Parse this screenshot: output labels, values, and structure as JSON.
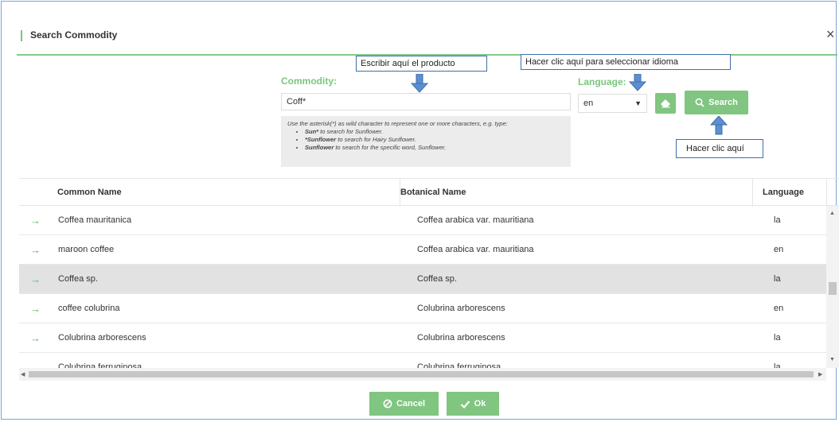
{
  "dialog": {
    "title": "Search Commodity",
    "close_label": "×"
  },
  "search": {
    "commodity_label": "Commodity:",
    "commodity_value": "Coff*",
    "language_label": "Language:",
    "language_value": "en",
    "hint_intro": "Use the asterisk(*) as wild character to represent one or more characters, e.g. type:",
    "hint_items": [
      {
        "bold": "Sun*",
        "text": " to search for Sunflower."
      },
      {
        "bold": "*Sunflower",
        "text": " to search for Hairy Sunflower."
      },
      {
        "bold": "Sunflower",
        "text": " to search for the specific word, Sunflower."
      }
    ],
    "search_label": "Search"
  },
  "callouts": {
    "product": "Escribir aquí el producto",
    "language": "Hacer clic aquí para seleccionar  idioma",
    "click": "Hacer clic aquí"
  },
  "table": {
    "headers": {
      "common": "Common Name",
      "botanical": "Botanical Name",
      "language": "Language"
    },
    "rows": [
      {
        "common": "Coffea mauritanica",
        "botanical": "Coffea arabica var. mauritiana",
        "language": "la"
      },
      {
        "common": "maroon coffee",
        "botanical": "Coffea arabica var. mauritiana",
        "language": "en"
      },
      {
        "common": "Coffea sp.",
        "botanical": "Coffea sp.",
        "language": "la"
      },
      {
        "common": "coffee colubrina",
        "botanical": "Colubrina arborescens",
        "language": "en"
      },
      {
        "common": "Colubrina arborescens",
        "botanical": "Colubrina arborescens",
        "language": "la"
      },
      {
        "common": "Colubrina ferruginosa",
        "botanical": "Colubrina ferruginosa",
        "language": "la"
      }
    ]
  },
  "footer": {
    "cancel_label": "Cancel",
    "ok_label": "Ok"
  },
  "colors": {
    "accent_green": "#80c580",
    "label_green": "#7ac67d",
    "callout_border": "#3f6fa8",
    "selected_row": "#e2e2e2"
  }
}
